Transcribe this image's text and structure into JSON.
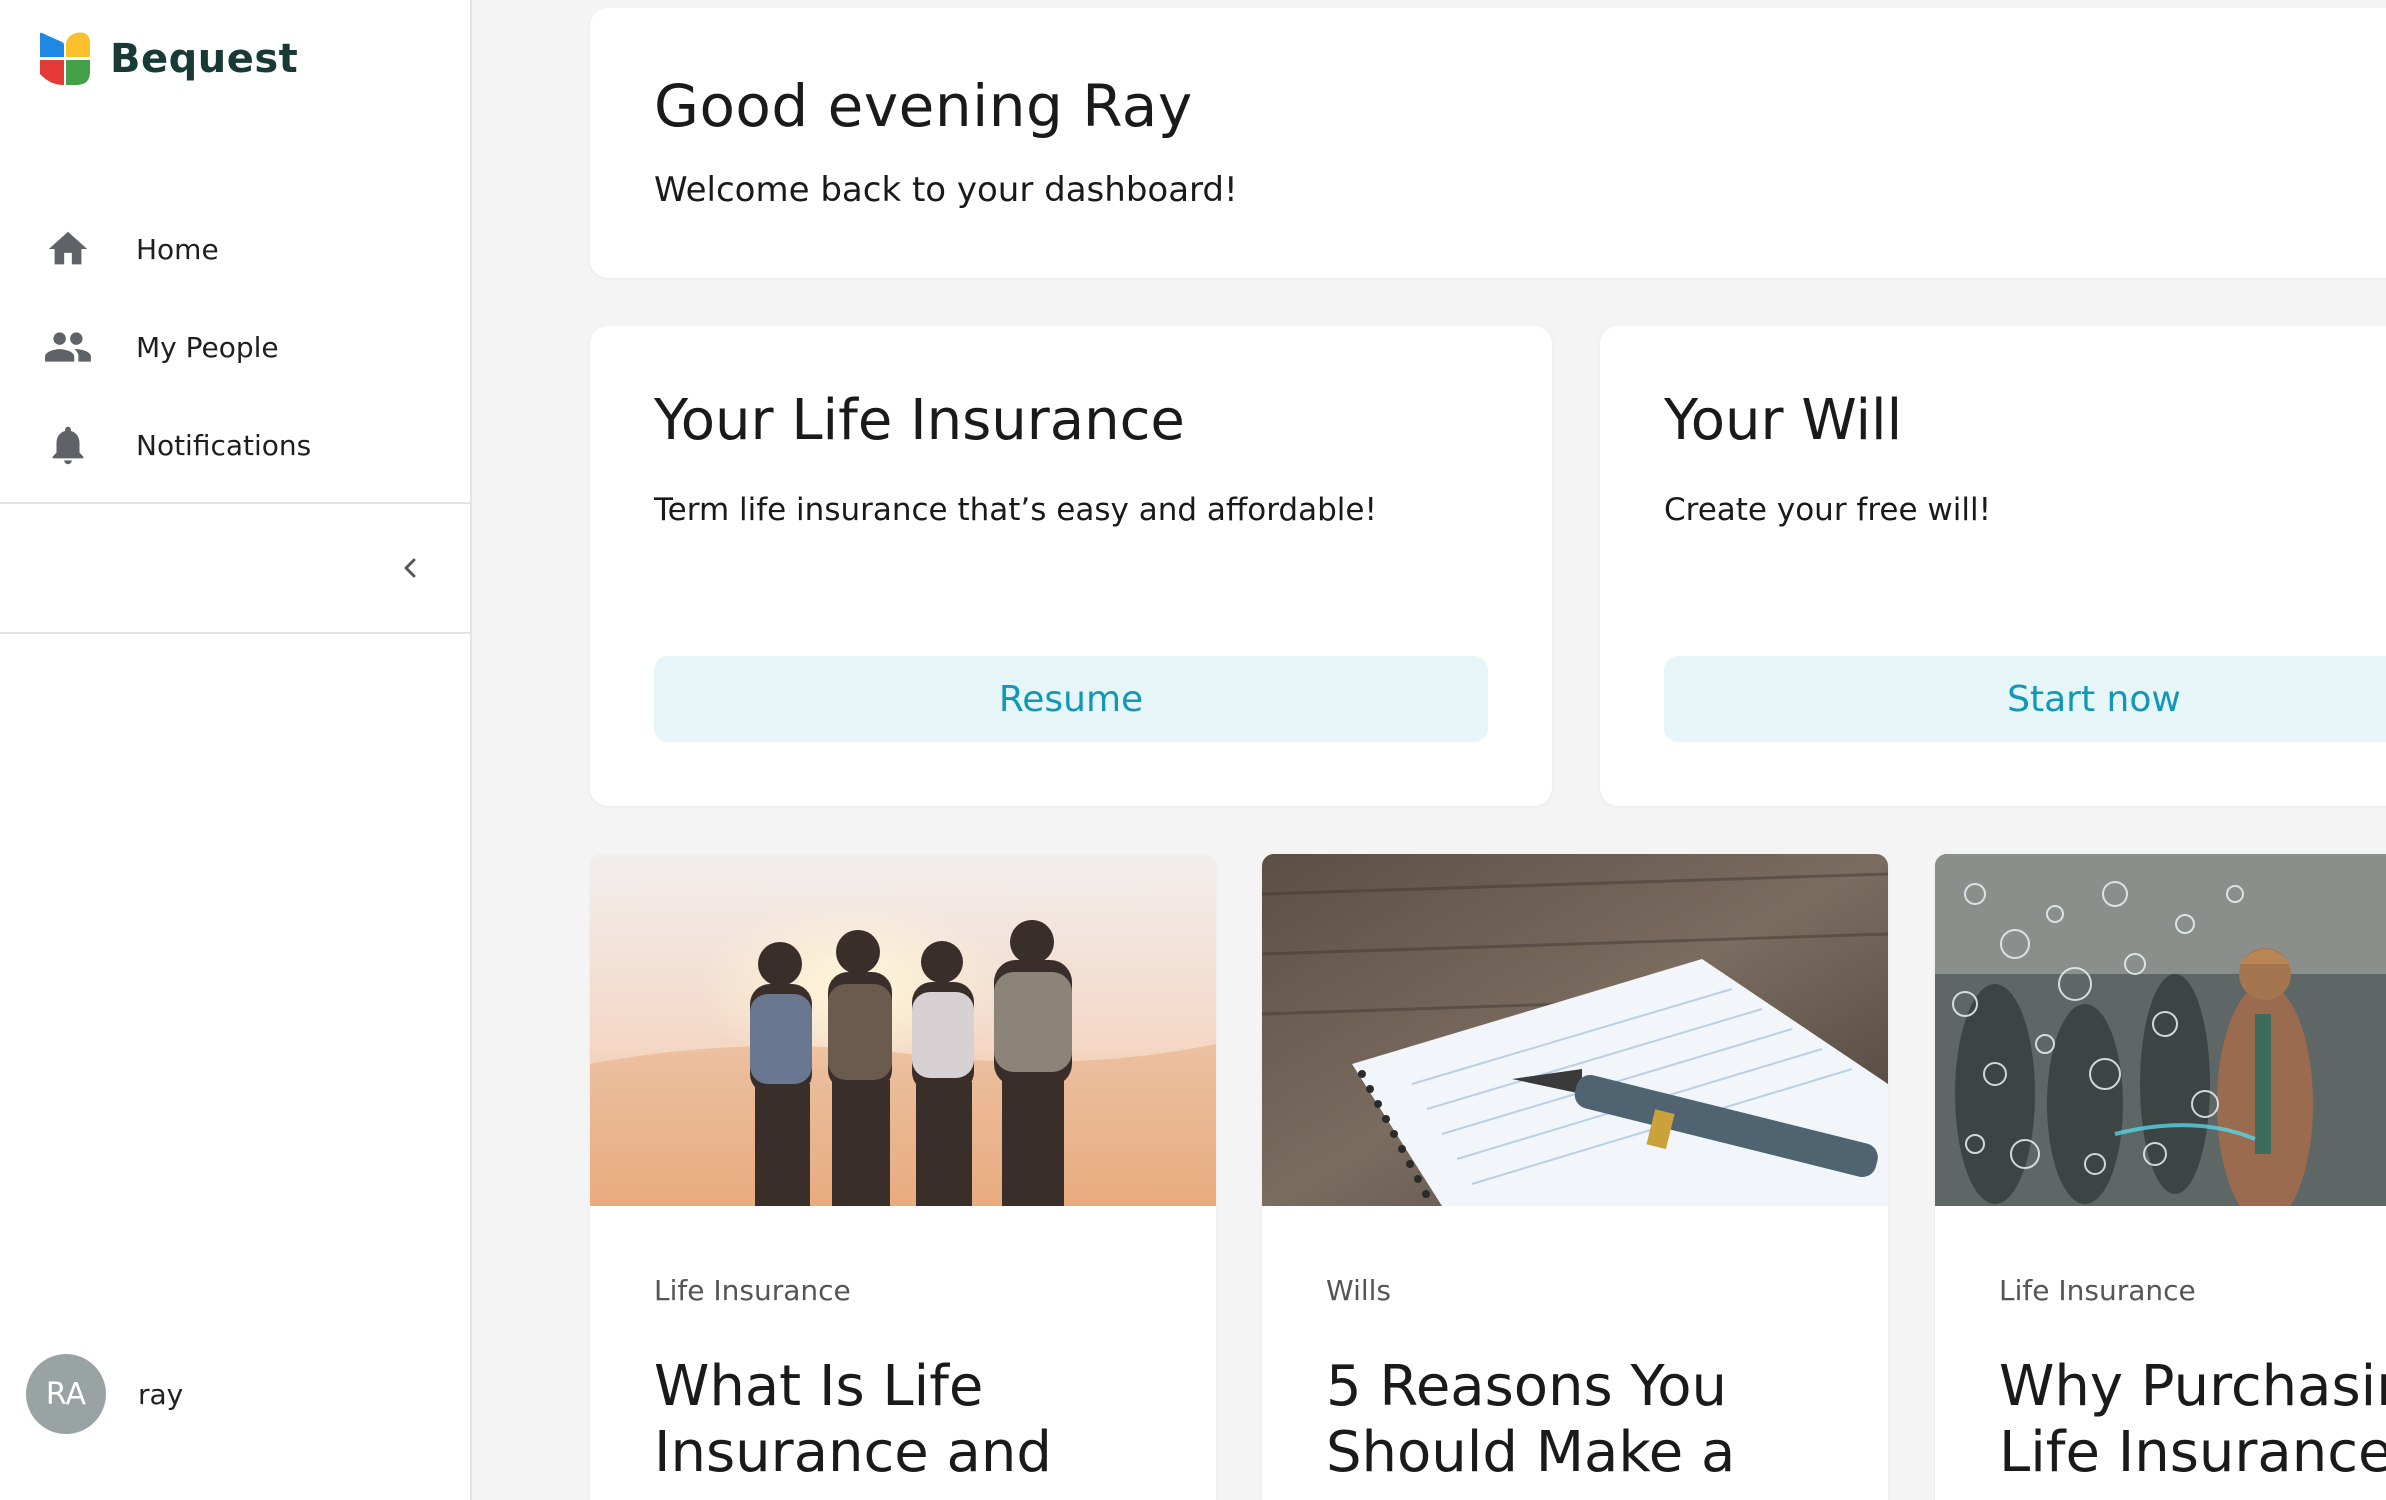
{
  "app": {
    "brand": "Bequest"
  },
  "sidebar": {
    "items": [
      {
        "label": "Home",
        "icon": "home-icon"
      },
      {
        "label": "My People",
        "icon": "people-icon"
      },
      {
        "label": "Notifications",
        "icon": "bell-icon"
      }
    ],
    "collapse_icon": "chevron-left-icon",
    "user": {
      "initials": "RA",
      "name": "ray"
    }
  },
  "welcome": {
    "title": "Good evening Ray",
    "subtitle": "Welcome back to your dashboard!"
  },
  "products": [
    {
      "title": "Your Life Insurance",
      "description": "Term life insurance that’s easy and affordable!",
      "button": "Resume"
    },
    {
      "title": "Your Will",
      "description": "Create your free will!",
      "button": "Start now"
    }
  ],
  "articles": [
    {
      "category": "Life Insurance",
      "title_line1": "What Is Life",
      "title_line2": "Insurance and"
    },
    {
      "category": "Wills",
      "title_line1": "5 Reasons You",
      "title_line2": "Should Make a"
    },
    {
      "category": "Life Insurance",
      "title_line1": "Why Purchasing",
      "title_line2": "Life Insurance"
    }
  ],
  "colors": {
    "accent": "#1297b6",
    "button_bg": "#e6f5f8",
    "brand_text": "#173a36",
    "page_bg": "#f4f4f4"
  }
}
